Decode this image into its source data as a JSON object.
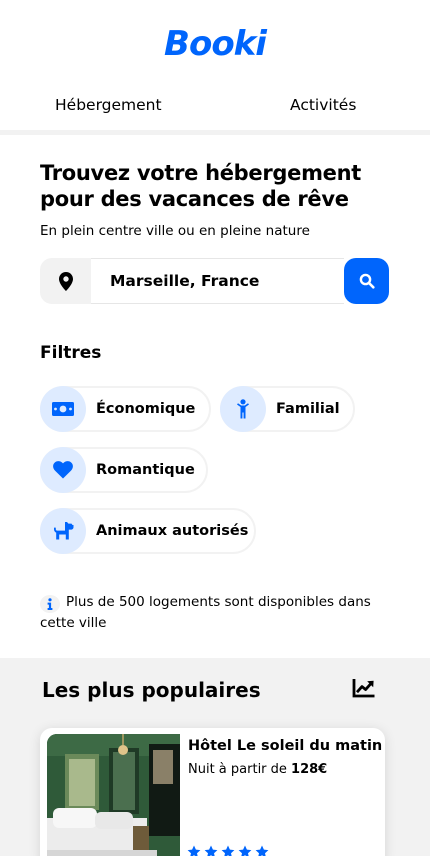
{
  "app": {
    "logo": "Booki"
  },
  "nav": {
    "items": [
      {
        "label": "Hébergement"
      },
      {
        "label": "Activités"
      }
    ]
  },
  "hero": {
    "title": "Trouvez votre hébergement pour des vacances de rêve",
    "subtitle": "En plein centre ville ou en pleine nature"
  },
  "search": {
    "value": "Marseille, France"
  },
  "filters": {
    "title": "Filtres",
    "items": [
      {
        "label": "Économique",
        "icon": "money-bill-icon"
      },
      {
        "label": "Familial",
        "icon": "child-icon"
      },
      {
        "label": "Romantique",
        "icon": "heart-icon"
      },
      {
        "label": "Animaux autorisés",
        "icon": "dog-icon"
      }
    ]
  },
  "info": {
    "text": "Plus de 500 logements sont disponibles dans cette ville"
  },
  "popular": {
    "title": "Les plus populaires",
    "cards": [
      {
        "name": "Hôtel Le soleil du matin",
        "price_prefix": "Nuit à partir de ",
        "price": "128€",
        "rating": 5
      }
    ]
  },
  "colors": {
    "accent": "#0065fc",
    "accent_light": "#deebff",
    "surface": "#f2f2f2"
  }
}
